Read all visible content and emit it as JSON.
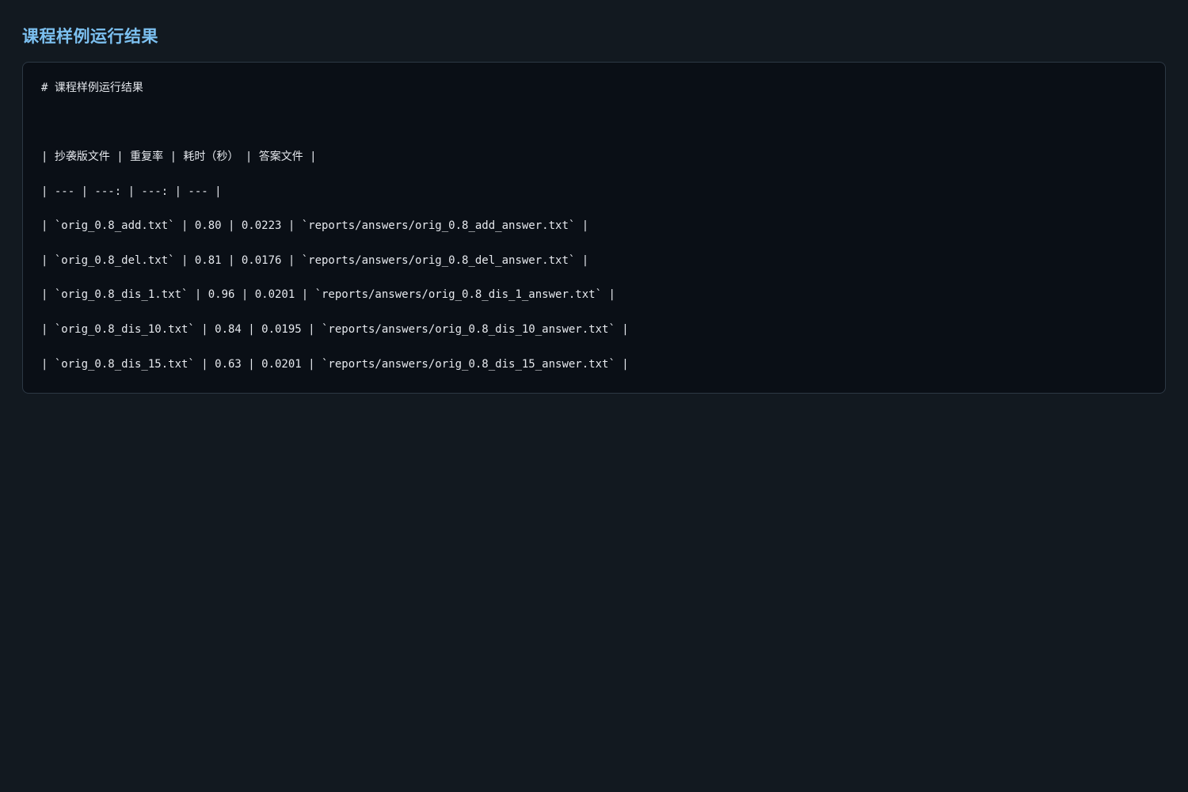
{
  "page": {
    "title": "课程样例运行结果"
  },
  "code": {
    "heading": "# 课程样例运行结果",
    "table_header": "| 抄袭版文件 | 重复率 | 耗时（秒） | 答案文件 |",
    "table_separator": "| --- | ---: | ---: | --- |",
    "rows": [
      "| `orig_0.8_add.txt` | 0.80 | 0.0223 | `reports/answers/orig_0.8_add_answer.txt` |",
      "| `orig_0.8_del.txt` | 0.81 | 0.0176 | `reports/answers/orig_0.8_del_answer.txt` |",
      "| `orig_0.8_dis_1.txt` | 0.96 | 0.0201 | `reports/answers/orig_0.8_dis_1_answer.txt` |",
      "| `orig_0.8_dis_10.txt` | 0.84 | 0.0195 | `reports/answers/orig_0.8_dis_10_answer.txt` |",
      "| `orig_0.8_dis_15.txt` | 0.63 | 0.0201 | `reports/answers/orig_0.8_dis_15_answer.txt` |"
    ]
  },
  "colors": {
    "background": "#121920",
    "panel": "#0a0f16",
    "title": "#7cc0f0",
    "text": "#e6e9ee",
    "border": "#2c3844"
  }
}
